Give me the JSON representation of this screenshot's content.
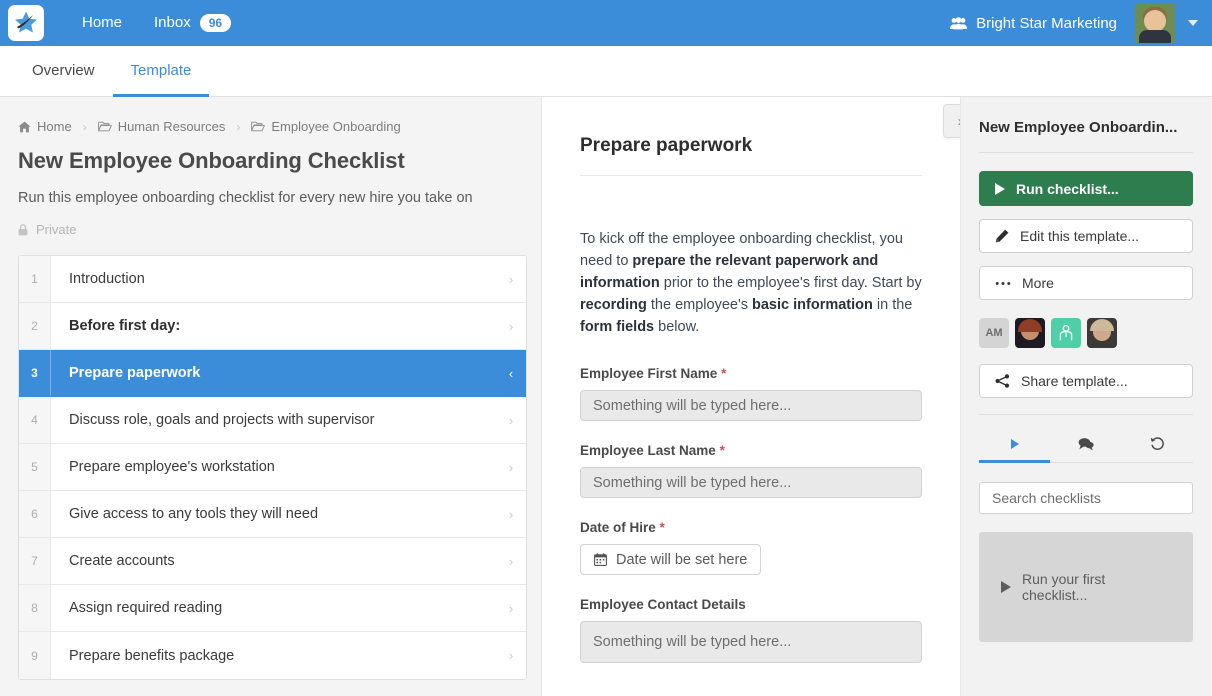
{
  "topnav": {
    "logo_icon": "star-logo-icon",
    "home_label": "Home",
    "inbox_label": "Inbox",
    "inbox_count": "96",
    "org_name": "Bright Star Marketing",
    "org_icon": "users-group-icon",
    "avatar_name": "user-avatar",
    "caret_icon": "chevron-down-icon"
  },
  "tabs": [
    {
      "label": "Overview",
      "active": false
    },
    {
      "label": "Template",
      "active": true
    }
  ],
  "left": {
    "breadcrumb": [
      {
        "label": "Home",
        "icon": "home-icon"
      },
      {
        "label": "Human Resources",
        "icon": "folder-icon"
      },
      {
        "label": "Employee Onboarding",
        "icon": "folder-icon"
      }
    ],
    "title": "New Employee Onboarding Checklist",
    "description": "Run this employee onboarding checklist for every new hire you take on",
    "privacy_label": "Private",
    "privacy_icon": "lock-icon",
    "tasks": [
      {
        "num": "1",
        "label": "Introduction",
        "bold": false,
        "selected": false
      },
      {
        "num": "2",
        "label": "Before first day:",
        "bold": true,
        "selected": false
      },
      {
        "num": "3",
        "label": "Prepare paperwork",
        "bold": true,
        "selected": true
      },
      {
        "num": "4",
        "label": "Discuss role, goals and projects with supervisor",
        "bold": false,
        "selected": false
      },
      {
        "num": "5",
        "label": "Prepare employee's workstation",
        "bold": false,
        "selected": false
      },
      {
        "num": "6",
        "label": "Give access to any tools they will need",
        "bold": false,
        "selected": false
      },
      {
        "num": "7",
        "label": "Create accounts",
        "bold": false,
        "selected": false
      },
      {
        "num": "8",
        "label": "Assign required reading",
        "bold": false,
        "selected": false
      },
      {
        "num": "9",
        "label": "Prepare benefits package",
        "bold": false,
        "selected": false
      }
    ]
  },
  "center": {
    "step_title": "Prepare paperwork",
    "body_html": "To kick off the employee onboarding checklist, you need to <b>prepare the relevant paperwork and information</b> prior to the employee's first day. Start by <b>recording</b> the employee's <b>basic information</b> in the <b>form fields</b> below.",
    "fields": [
      {
        "label": "Employee First Name",
        "required": true,
        "type": "text",
        "placeholder": "Something will be typed here..."
      },
      {
        "label": "Employee Last Name",
        "required": true,
        "type": "text",
        "placeholder": "Something will be typed here..."
      },
      {
        "label": "Date of Hire",
        "required": true,
        "type": "date",
        "placeholder": "Date will be set here",
        "icon": "calendar-icon"
      },
      {
        "label": "Employee Contact Details",
        "required": false,
        "type": "textarea",
        "placeholder": "Something will be typed here..."
      }
    ],
    "toggle_icon": "chevron-right-icon"
  },
  "right": {
    "title": "New Employee Onboardin...",
    "buttons": [
      {
        "label": "Run checklist...",
        "icon": "play-icon",
        "style": "primary"
      },
      {
        "label": "Edit this template...",
        "icon": "pencil-icon",
        "style": "default"
      },
      {
        "label": "More",
        "icon": "ellipsis-icon",
        "style": "default"
      }
    ],
    "avatars": [
      {
        "type": "initials",
        "label": "AM"
      },
      {
        "type": "photo",
        "label": ""
      },
      {
        "type": "placeholder",
        "label": ""
      },
      {
        "type": "photo",
        "label": ""
      }
    ],
    "share_button": {
      "label": "Share template...",
      "icon": "share-icon"
    },
    "icon_tabs": [
      {
        "icon": "play-icon",
        "active": true
      },
      {
        "icon": "comments-icon",
        "active": false
      },
      {
        "icon": "history-icon",
        "active": false
      }
    ],
    "search_placeholder": "Search checklists",
    "empty_state": {
      "label": "Run your first checklist...",
      "icon": "play-icon"
    }
  }
}
